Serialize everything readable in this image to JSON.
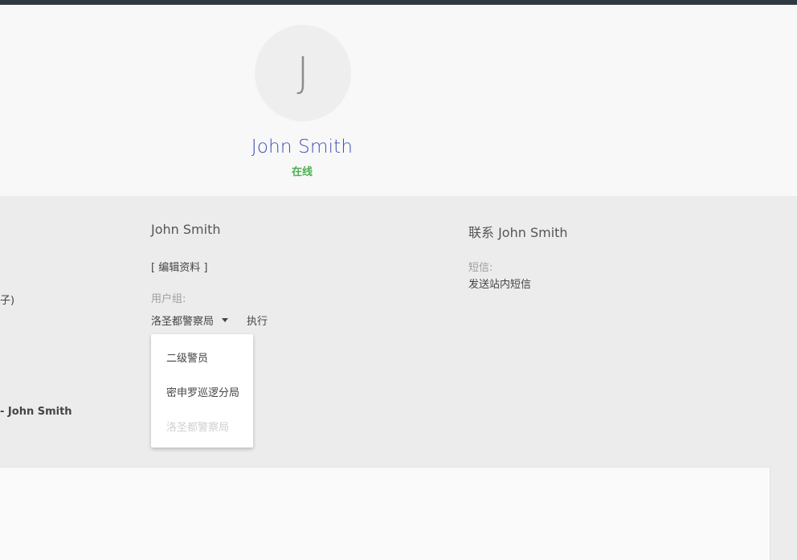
{
  "header": {
    "avatar_initial": "J",
    "name": "John Smith",
    "status": "在线",
    "status_color": "#4caf50",
    "name_color": "#3f51b5"
  },
  "left_fragments": {
    "fragment_1": "子)",
    "fragment_2": "- John Smith"
  },
  "profile": {
    "title": "John Smith",
    "edit_link": "[ 编辑资料 ]",
    "usergroup_label": "用户组:",
    "usergroup_selected": "洛圣都警察局",
    "execute_label": "执行",
    "dropdown_options": [
      {
        "label": "二级警员",
        "disabled": false
      },
      {
        "label": "密申罗巡逻分局",
        "disabled": false
      },
      {
        "label": "洛圣都警察局",
        "disabled": true
      }
    ]
  },
  "contact": {
    "title": "联系 John Smith",
    "sms_label": "短信:",
    "sms_link": "发送站内短信"
  }
}
